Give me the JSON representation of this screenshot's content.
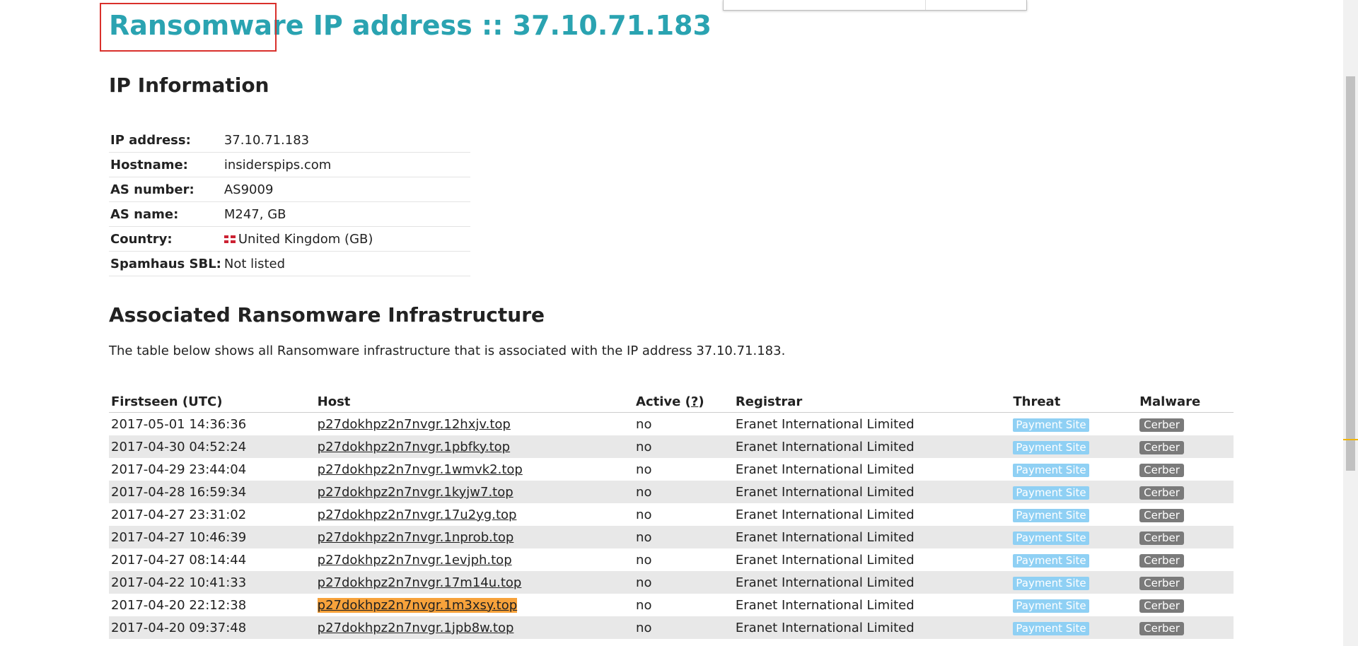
{
  "title": {
    "highlighted": "Ransomware",
    "rest": " IP address :: 37.10.71.183"
  },
  "ip_info": {
    "heading": "IP Information",
    "rows": [
      {
        "key": "IP address:",
        "value": "37.10.71.183"
      },
      {
        "key": "Hostname:",
        "value": "insiderspips.com"
      },
      {
        "key": "AS number:",
        "value": "AS9009"
      },
      {
        "key": "AS name:",
        "value": "M247, GB"
      },
      {
        "key": "Country:",
        "value": "United Kingdom (GB)",
        "icon": "uk-flag-icon"
      },
      {
        "key": "Spamhaus SBL:",
        "value": "Not listed"
      }
    ]
  },
  "infra": {
    "heading": "Associated Ransomware Infrastructure",
    "description": "The table below shows all Ransomware infrastructure that is associated with the IP address 37.10.71.183.",
    "columns": {
      "firstseen": "Firstseen (UTC)",
      "host": "Host",
      "active": "Active (",
      "active_help": "?",
      "active_close": ")",
      "registrar": "Registrar",
      "threat": "Threat",
      "malware": "Malware"
    },
    "rows": [
      {
        "firstseen": "2017-05-01 14:36:36",
        "host": "p27dokhpz2n7nvgr.12hxjv.top",
        "active": "no",
        "registrar": "Eranet International Limited",
        "threat": "Payment Site",
        "malware": "Cerber"
      },
      {
        "firstseen": "2017-04-30 04:52:24",
        "host": "p27dokhpz2n7nvgr.1pbfky.top",
        "active": "no",
        "registrar": "Eranet International Limited",
        "threat": "Payment Site",
        "malware": "Cerber"
      },
      {
        "firstseen": "2017-04-29 23:44:04",
        "host": "p27dokhpz2n7nvgr.1wmvk2.top",
        "active": "no",
        "registrar": "Eranet International Limited",
        "threat": "Payment Site",
        "malware": "Cerber"
      },
      {
        "firstseen": "2017-04-28 16:59:34",
        "host": "p27dokhpz2n7nvgr.1kyjw7.top",
        "active": "no",
        "registrar": "Eranet International Limited",
        "threat": "Payment Site",
        "malware": "Cerber"
      },
      {
        "firstseen": "2017-04-27 23:31:02",
        "host": "p27dokhpz2n7nvgr.17u2yg.top",
        "active": "no",
        "registrar": "Eranet International Limited",
        "threat": "Payment Site",
        "malware": "Cerber"
      },
      {
        "firstseen": "2017-04-27 10:46:39",
        "host": "p27dokhpz2n7nvgr.1nprob.top",
        "active": "no",
        "registrar": "Eranet International Limited",
        "threat": "Payment Site",
        "malware": "Cerber"
      },
      {
        "firstseen": "2017-04-27 08:14:44",
        "host": "p27dokhpz2n7nvgr.1evjph.top",
        "active": "no",
        "registrar": "Eranet International Limited",
        "threat": "Payment Site",
        "malware": "Cerber"
      },
      {
        "firstseen": "2017-04-22 10:41:33",
        "host": "p27dokhpz2n7nvgr.17m14u.top",
        "active": "no",
        "registrar": "Eranet International Limited",
        "threat": "Payment Site",
        "malware": "Cerber"
      },
      {
        "firstseen": "2017-04-20 22:12:38",
        "host": "p27dokhpz2n7nvgr.1m3xsy.top",
        "active": "no",
        "registrar": "Eranet International Limited",
        "threat": "Payment Site",
        "malware": "Cerber"
      },
      {
        "firstseen": "2017-04-20 09:37:48",
        "host": "p27dokhpz2n7nvgr.1jpb8w.top",
        "active": "no",
        "registrar": "Eranet International Limited",
        "threat": "Payment Site",
        "malware": "Cerber"
      }
    ]
  },
  "colors": {
    "title": "#2aa3b1",
    "highlight_box": "#d9302b",
    "selected_host": "#f7a23b",
    "threat_badge": "#8fd0f4",
    "malware_badge": "#7a7a7a"
  }
}
